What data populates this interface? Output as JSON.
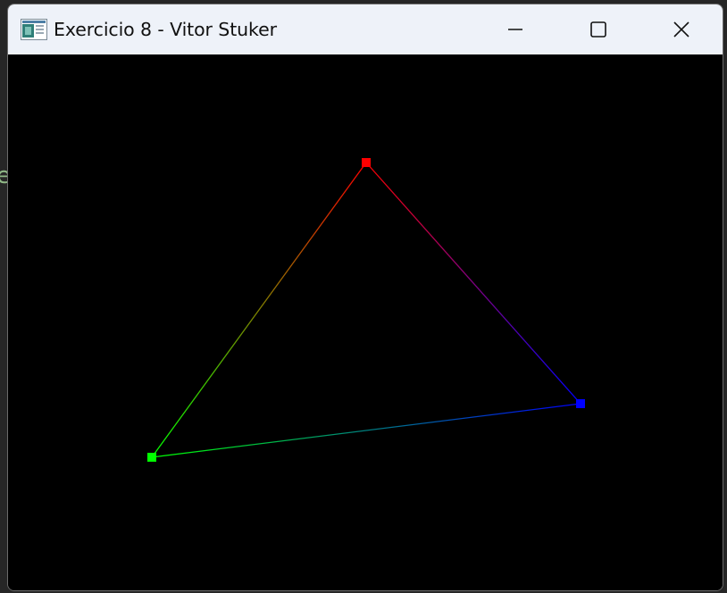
{
  "window": {
    "title": "Exercicio 8 - Vitor Stuker"
  },
  "icons": {
    "app": "application-window-icon",
    "minimize": "minimize-icon",
    "maximize": "maximize-icon",
    "close": "close-icon"
  },
  "scene": {
    "background_color": "#000000",
    "vertices": [
      {
        "name": "red-vertex",
        "color": "#ff0000"
      },
      {
        "name": "blue-vertex",
        "color": "#0000ff"
      },
      {
        "name": "green-vertex",
        "color": "#00ff00"
      }
    ],
    "edges": [
      {
        "name": "edge-red-blue",
        "from": 0,
        "to": 1
      },
      {
        "name": "edge-blue-green",
        "from": 1,
        "to": 2
      },
      {
        "name": "edge-green-red",
        "from": 2,
        "to": 0
      }
    ]
  }
}
